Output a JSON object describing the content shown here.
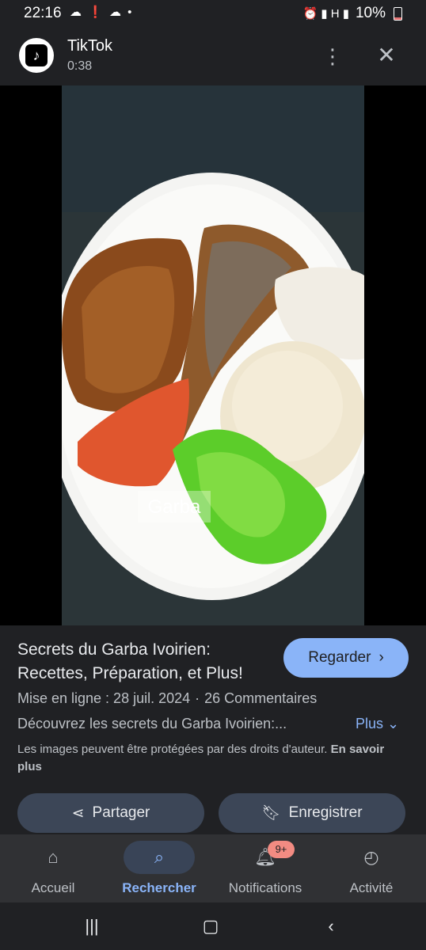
{
  "status_bar": {
    "time": "22:16",
    "left_icons": "☁ ❗ ☁ •",
    "signal_icons": "⏰ ▮ H ▮",
    "battery": "10%"
  },
  "app": {
    "name": "TikTok",
    "duration": "0:38"
  },
  "media": {
    "overlay_text": "Garba"
  },
  "result": {
    "title": "Secrets du Garba Ivoirien: Recettes, Préparation, et Plus!",
    "watch_label": "Regarder",
    "published": "Mise en ligne : 28 juil. 2024",
    "separator": "·",
    "comments": "26 Commentaires",
    "description": "Découvrez les secrets du Garba Ivoirien:...",
    "more_label": "Plus",
    "copyright_notice": "Les images peuvent être protégées par des droits d'auteur.",
    "learn_more": "En savoir plus",
    "share_label": "Partager",
    "save_label": "Enregistrer"
  },
  "bottom_nav": {
    "items": [
      {
        "label": "Accueil",
        "icon": "home-icon"
      },
      {
        "label": "Rechercher",
        "icon": "search-icon"
      },
      {
        "label": "Notifications",
        "icon": "bell-icon",
        "badge": "9+"
      },
      {
        "label": "Activité",
        "icon": "history-icon"
      }
    ],
    "active_index": 1
  },
  "colors": {
    "accent": "#8ab4f8",
    "background": "#202124",
    "badge": "#f28b82"
  }
}
